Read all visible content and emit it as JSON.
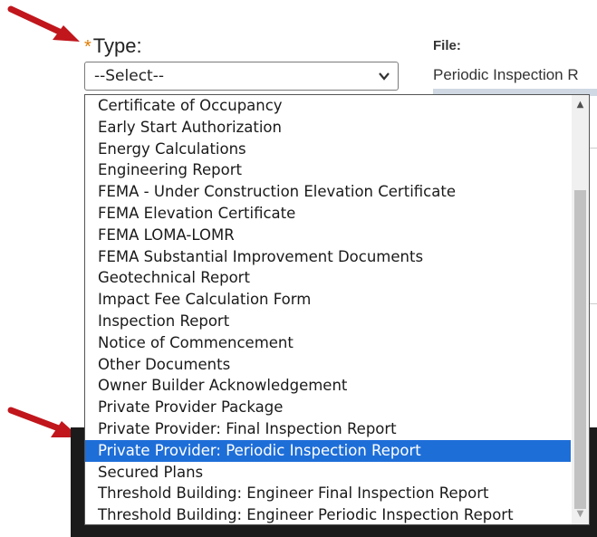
{
  "form": {
    "type_required_marker": "*",
    "type_label": "Type:",
    "file_label": "File:",
    "file_name": "Periodic Inspection R"
  },
  "select": {
    "value": "--Select--",
    "options": [
      "Certificate of Occupancy",
      "Early Start Authorization",
      "Energy Calculations",
      "Engineering Report",
      "FEMA - Under Construction Elevation Certificate",
      "FEMA Elevation Certificate",
      "FEMA LOMA-LOMR",
      "FEMA Substantial Improvement Documents",
      "Geotechnical Report",
      "Impact Fee Calculation Form",
      "Inspection Report",
      "Notice of Commencement",
      "Other Documents",
      "Owner Builder Acknowledgement",
      "Private Provider Package",
      "Private Provider: Final Inspection Report",
      "Private Provider: Periodic Inspection Report",
      "Secured Plans",
      "Threshold Building: Engineer Final Inspection Report",
      "Threshold Building: Engineer Periodic Inspection Report"
    ],
    "selected": "Private Provider: Periodic Inspection Report"
  },
  "colors": {
    "annotation_arrow": "#c0161c",
    "required_marker": "#e07b00",
    "selection_highlight": "#1e6ed8"
  },
  "icons": {
    "select_chevron": "chevron-down-icon",
    "scroll_up": "scroll-up-icon",
    "scroll_down": "scroll-down-icon"
  }
}
